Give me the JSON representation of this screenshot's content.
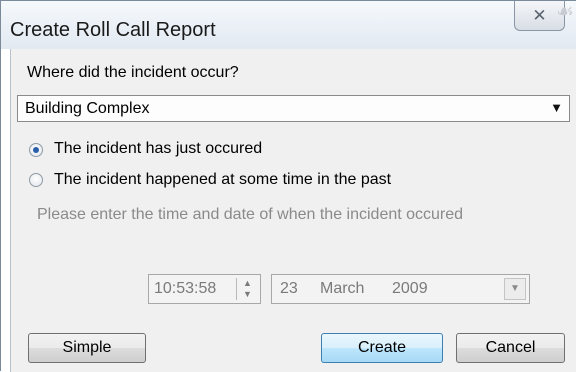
{
  "window": {
    "title": "Create Roll Call Report",
    "close_icon": "close-icon"
  },
  "location": {
    "question": "Where did the incident occur?",
    "selected": "Building Complex"
  },
  "timing": {
    "option_now": "The incident has just occured",
    "option_past": "The incident happened at some time in the past",
    "selected": "now",
    "hint": "Please enter the time and date of when the incident occured"
  },
  "datetime": {
    "time": "10:53:58",
    "day": "23",
    "month": "March",
    "year": "2009"
  },
  "buttons": {
    "simple": "Simple",
    "create": "Create",
    "cancel": "Cancel"
  },
  "colors": {
    "radio_selected": "#2a5ea8",
    "default_button": "#bee6fd"
  }
}
